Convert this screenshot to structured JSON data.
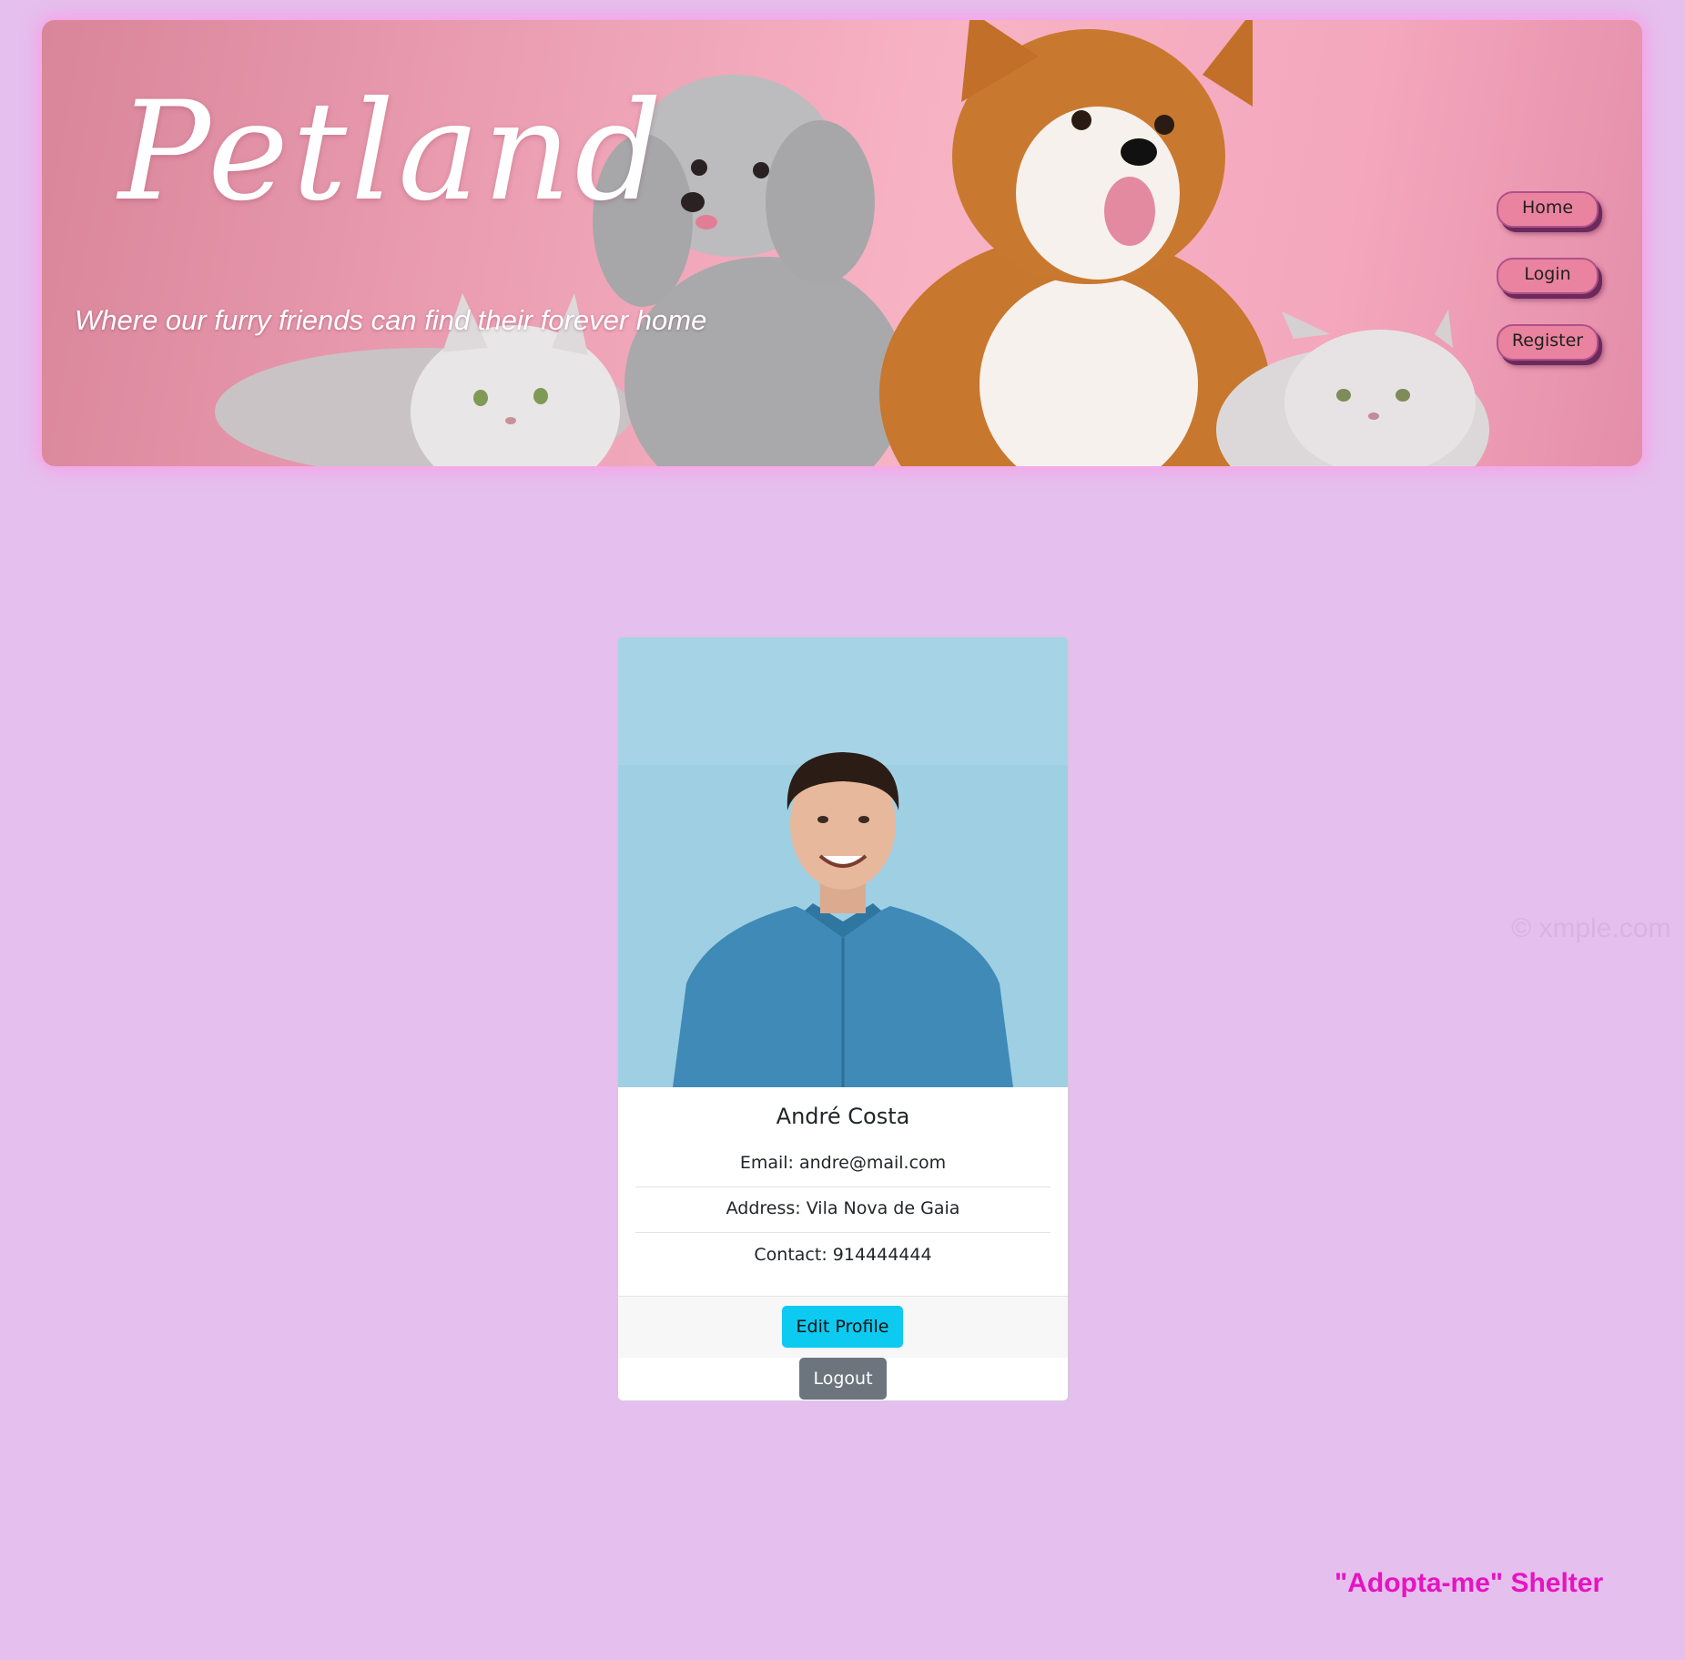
{
  "header": {
    "brand": "Petland",
    "tagline": "Where our furry friends can find their forever home",
    "banner_image": "pets-cats-poodle-corgi-banner",
    "nav": [
      {
        "label": "Home"
      },
      {
        "label": "Login"
      },
      {
        "label": "Register"
      }
    ]
  },
  "profile": {
    "photo": "profile-photo-man-blue-shirt",
    "name": "André Costa",
    "email": "Email: andre@mail.com",
    "address": "Address: Vila Nova de Gaia",
    "contact": "Contact: 914444444",
    "edit_label": "Edit Profile",
    "logout_label": "Logout"
  },
  "watermark": "© xmple.com",
  "footer": {
    "shelter": "\"Adopta-me\" Shelter"
  },
  "colors": {
    "page_background": "#e5bfed",
    "banner_pink": "#f4a7bd",
    "nav_button": "#e9839f",
    "edit_button": "#0dcaf0",
    "logout_button": "#6c757d",
    "footer_text": "#e514c2"
  }
}
